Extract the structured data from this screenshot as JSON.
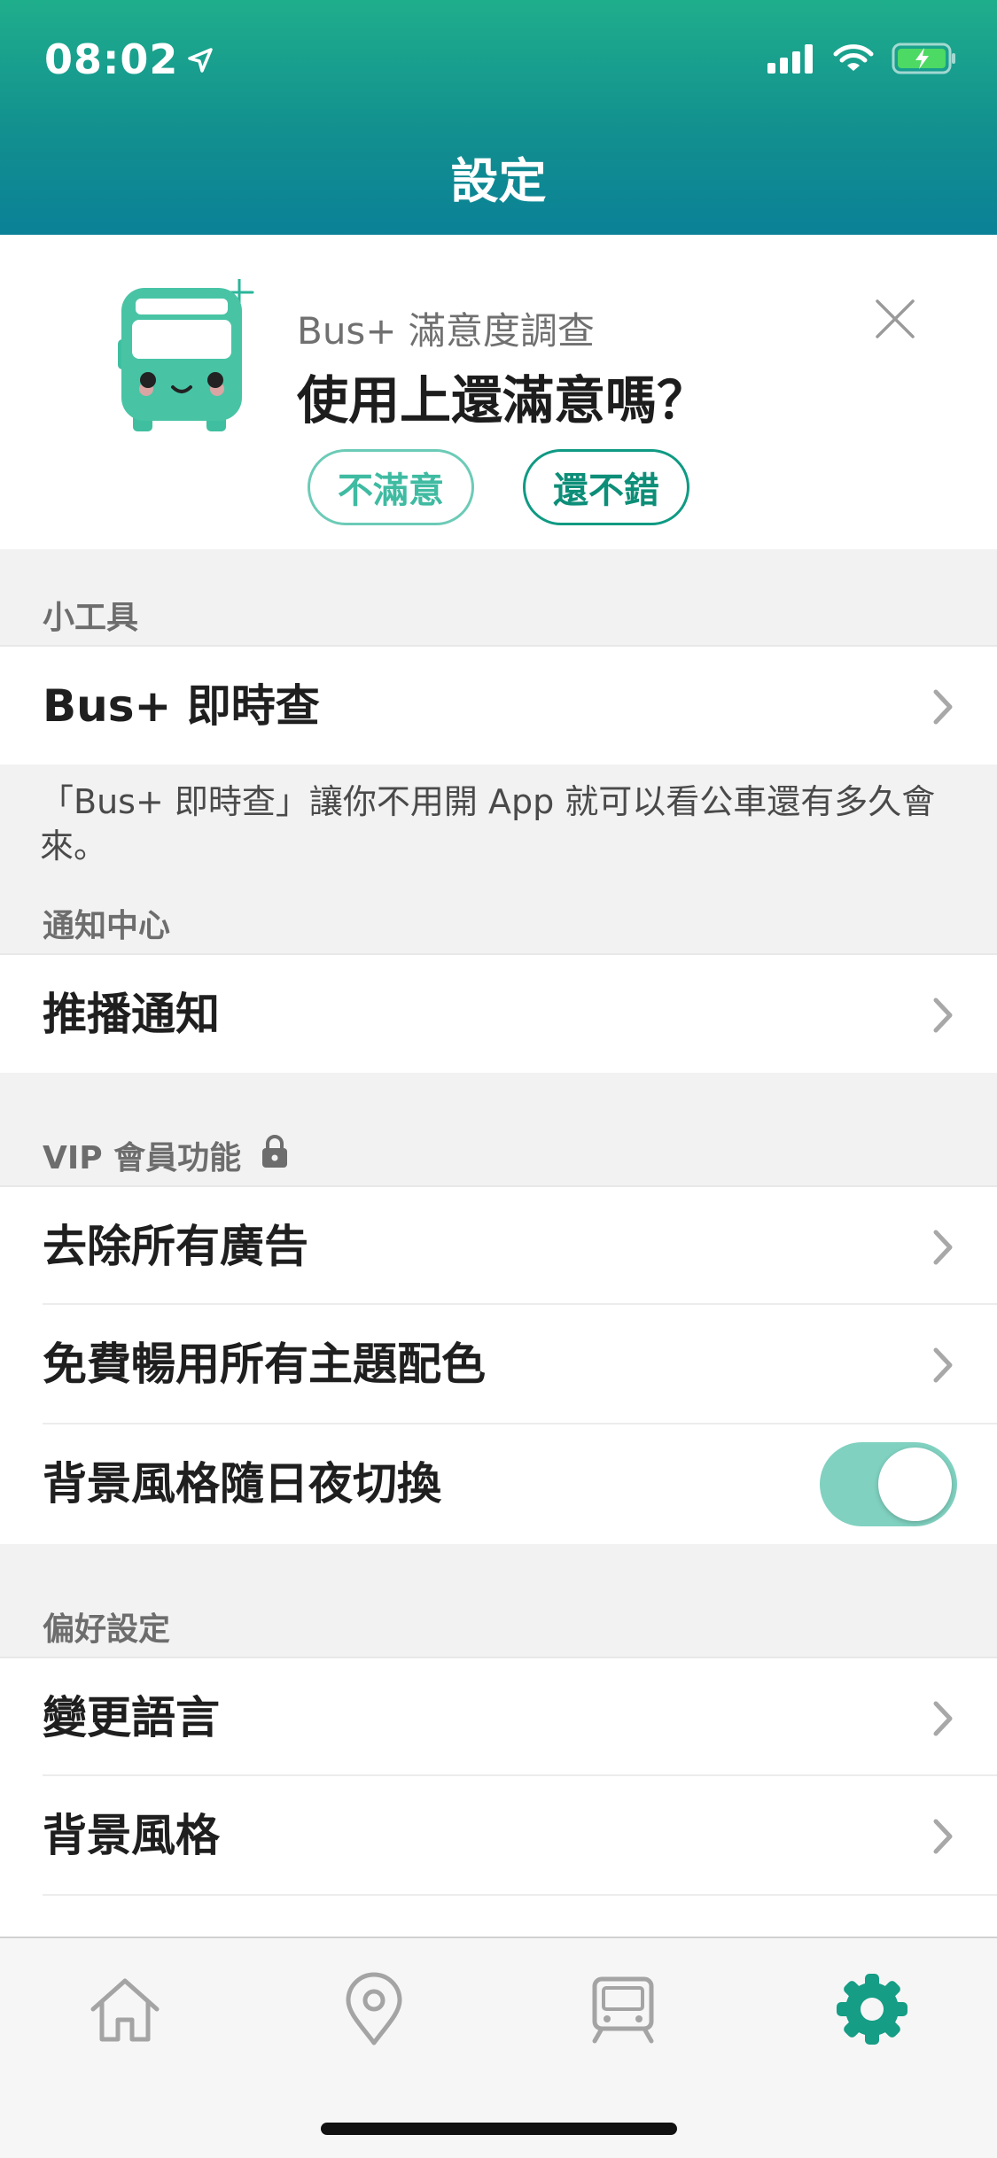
{
  "status_bar": {
    "time": "08:02"
  },
  "header": {
    "title": "設定"
  },
  "survey": {
    "subtitle": "Bus+ 滿意度調查",
    "question": "使用上還滿意嗎？",
    "option_unsatisfied": "不滿意",
    "option_satisfied": "還不錯"
  },
  "sections": {
    "tools": {
      "header": "小工具",
      "item_label": "Bus+ 即時查",
      "note": "「Bus+ 即時查」讓你不用開 App 就可以看公車還有多久會來。"
    },
    "notifications": {
      "header": "通知中心",
      "item_label": "推播通知"
    },
    "vip": {
      "header": "VIP 會員功能",
      "items": [
        {
          "label": "去除所有廣告"
        },
        {
          "label": "免費暢用所有主題配色"
        },
        {
          "label": "背景風格隨日夜切換",
          "toggle_on": true
        }
      ]
    },
    "preferences": {
      "header": "偏好設定",
      "items": [
        {
          "label": "變更語言"
        },
        {
          "label": "背景風格"
        }
      ]
    }
  },
  "tabbar": {
    "tabs": [
      {
        "icon": "home-icon",
        "active": false
      },
      {
        "icon": "location-pin-icon",
        "active": false
      },
      {
        "icon": "train-icon",
        "active": false
      },
      {
        "icon": "gear-icon",
        "active": true
      }
    ],
    "active_color": "#159d85",
    "inactive_color": "#a4a4a4"
  },
  "colors": {
    "accent": "#1aa88d",
    "toggle_on": "#80d1c0"
  }
}
